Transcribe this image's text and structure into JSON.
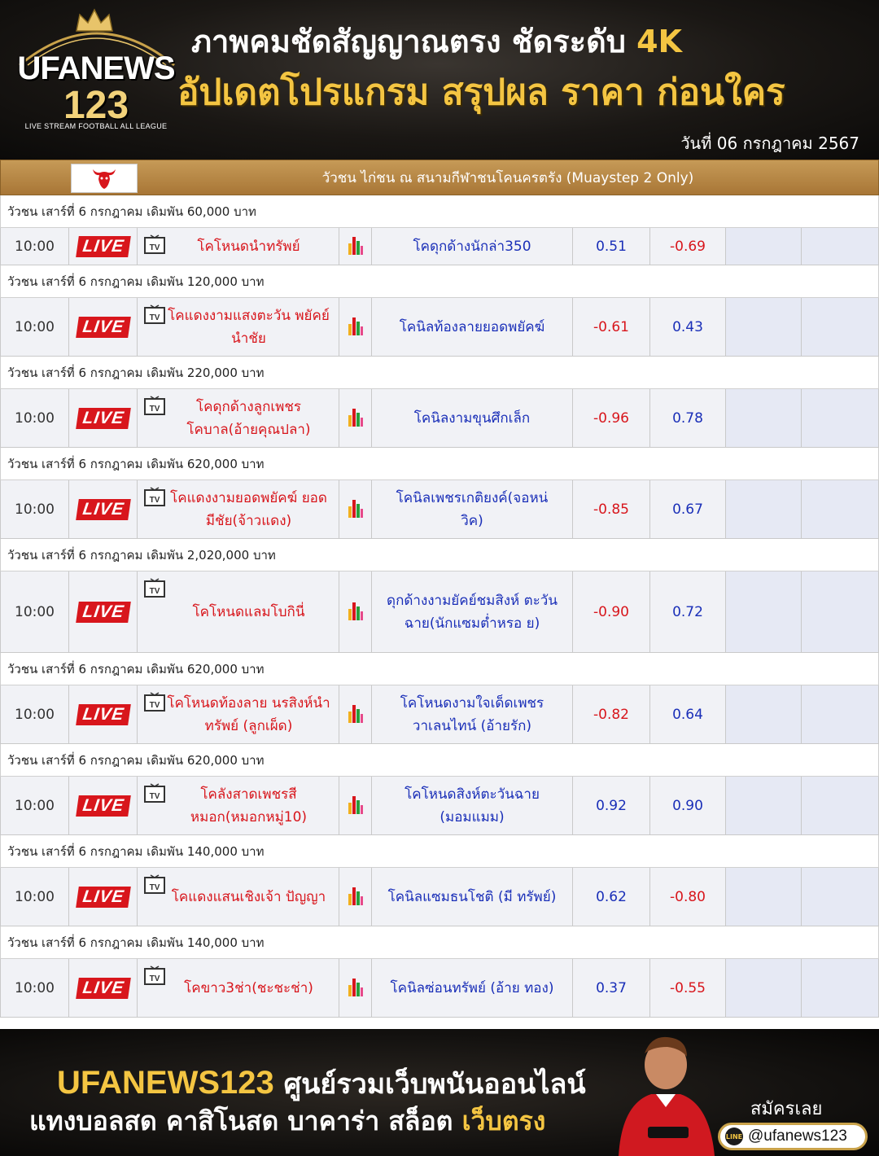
{
  "header": {
    "logo_name": "UFANEWS",
    "logo_number": "123",
    "logo_tagline": "LIVE STREAM FOOTBALL ALL LEAGUE",
    "line1_text": "ภาพคมชัดสัญญาณตรง ชัดระดับ",
    "line1_highlight": "4K",
    "line2_text": "อัปเดตโปรแกรม สรุปผล ราคา ก่อนใคร",
    "date": "วันที่ 06 กรกฎาคม 2567"
  },
  "league": {
    "title": "วัวชน ไก่ชน ณ สนามกีฬาชนโคนครตรัง (Muaystep 2 Only)",
    "logo_icon": "bull-head-icon"
  },
  "live_label": "LIVE",
  "groups": [
    {
      "label": "วัวชน เสาร์ที่ 6 กรกฎาคม เดิมพัน 60,000 บาท",
      "time": "10:00",
      "home": "โคโหนดนำทรัพย์",
      "away": "โคดุกด้างนักล่า350",
      "odd1": "0.51",
      "odd2": "-0.69"
    },
    {
      "label": "วัวชน เสาร์ที่ 6 กรกฎาคม เดิมพัน 120,000 บาท",
      "time": "10:00",
      "home": "โคแดงงามแสงตะวัน พยัคย์นำชัย",
      "away": "โคนิลท้องลายยอดพยัคฆ์",
      "odd1": "-0.61",
      "odd2": "0.43"
    },
    {
      "label": "วัวชน เสาร์ที่ 6 กรกฎาคม เดิมพัน 220,000 บาท",
      "time": "10:00",
      "home": "โคดุกด้างลูกเพชร โคบาล(อ้ายคุณปลา)",
      "away": "โคนิลงามขุนศึกเล็ก",
      "odd1": "-0.96",
      "odd2": "0.78"
    },
    {
      "label": "วัวชน เสาร์ที่ 6 กรกฎาคม เดิมพัน 620,000 บาท",
      "time": "10:00",
      "home": "โคแดงงามยอดพยัคฆ์ ยอดมีชัย(จ้าวแดง)",
      "away": "โคนิลเพชรเกติยงค์(จอหน่ วิค)",
      "odd1": "-0.85",
      "odd2": "0.67"
    },
    {
      "label": "วัวชน เสาร์ที่ 6 กรกฎาคม เดิมพัน 2,020,000 บาท",
      "time": "10:00",
      "home": "โคโหนดแลมโบกินี่",
      "away": "ดุกด้างงามยัคย์ชมสิงห์ ตะวันฉาย(นักแซมต่ำหรอ ย)",
      "odd1": "-0.90",
      "odd2": "0.72"
    },
    {
      "label": "วัวชน เสาร์ที่ 6 กรกฎาคม เดิมพัน 620,000 บาท",
      "time": "10:00",
      "home": "โคโหนดท้องลาย นรสิงห์นำทรัพย์ (ลูกเผ็ด)",
      "away": "โคโหนดงามใจเด็ดเพชร วาเลนไทน์ (อ้ายรัก)",
      "odd1": "-0.82",
      "odd2": "0.64"
    },
    {
      "label": "วัวชน เสาร์ที่ 6 กรกฎาคม เดิมพัน 620,000 บาท",
      "time": "10:00",
      "home": "โคลังสาดเพชรสี หมอก(หมอกหมู่10)",
      "away": "โคโหนดสิงห์ตะวันฉาย (มอมแมม)",
      "odd1": "0.92",
      "odd2": "0.90"
    },
    {
      "label": "วัวชน เสาร์ที่ 6 กรกฎาคม เดิมพัน 140,000 บาท",
      "time": "10:00",
      "home": "โคแดงแสนเชิงเจ้า ปัญญา",
      "away": "โคนิลแซมธนโชติ (มี ทรัพย์)",
      "odd1": "0.62",
      "odd2": "-0.80"
    },
    {
      "label": "วัวชน เสาร์ที่ 6 กรกฎาคม เดิมพัน 140,000 บาท",
      "time": "10:00",
      "home": "โคขาว3ช่า(ชะชะช่า)",
      "away": "โคนิลซ่อนทรัพย์ (อ้าย ทอง)",
      "odd1": "0.37",
      "odd2": "-0.55"
    }
  ],
  "colors": {
    "accent_gold": "#f4c542",
    "live_red": "#d8161c",
    "team_blue": "#1a2fb8",
    "league_bar": "#b8884a"
  },
  "footer": {
    "brand": "UFANEWS123",
    "line1_text": "ศูนย์รวมเว็บพนันออนไลน์",
    "line2_text": "แทงบอลสด คาสิโนสด บาคาร่า สล็อต",
    "line2_highlight": "เว็บตรง",
    "signup_label": "สมัครเลย",
    "line_badge": "LINE",
    "line_handle": "@ufanews123"
  }
}
